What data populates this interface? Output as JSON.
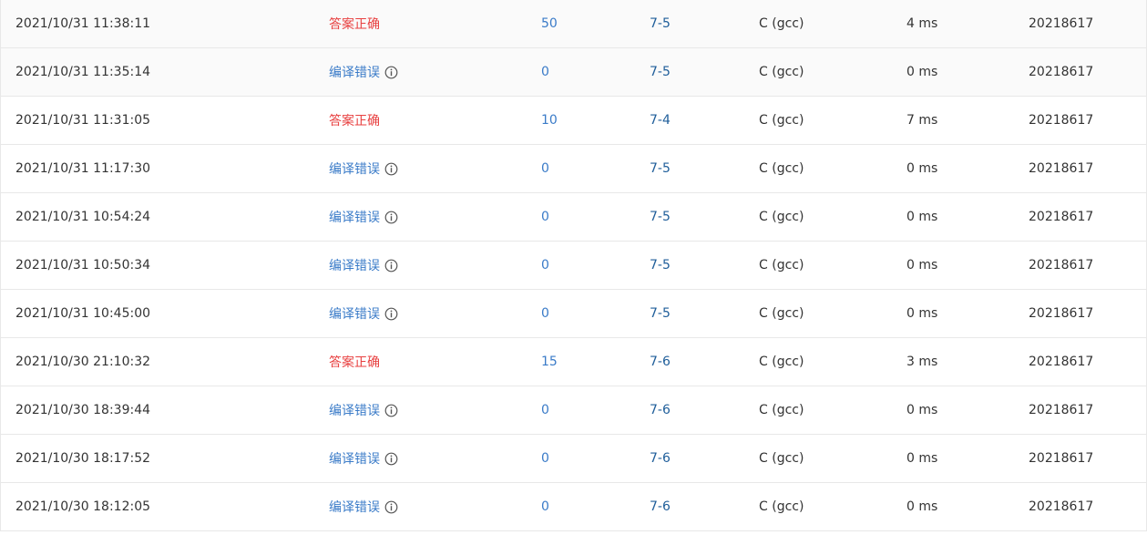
{
  "submissions": [
    {
      "time": "2021/10/31 11:38:11",
      "status": "答案正确",
      "status_type": "ok",
      "score": "50",
      "problem": "7-5",
      "language": "C (gcc)",
      "time_cost": "4 ms",
      "user": "20218617"
    },
    {
      "time": "2021/10/31 11:35:14",
      "status": "编译错误",
      "status_type": "ce",
      "score": "0",
      "problem": "7-5",
      "language": "C (gcc)",
      "time_cost": "0 ms",
      "user": "20218617"
    },
    {
      "time": "2021/10/31 11:31:05",
      "status": "答案正确",
      "status_type": "ok",
      "score": "10",
      "problem": "7-4",
      "language": "C (gcc)",
      "time_cost": "7 ms",
      "user": "20218617"
    },
    {
      "time": "2021/10/31 11:17:30",
      "status": "编译错误",
      "status_type": "ce",
      "score": "0",
      "problem": "7-5",
      "language": "C (gcc)",
      "time_cost": "0 ms",
      "user": "20218617"
    },
    {
      "time": "2021/10/31 10:54:24",
      "status": "编译错误",
      "status_type": "ce",
      "score": "0",
      "problem": "7-5",
      "language": "C (gcc)",
      "time_cost": "0 ms",
      "user": "20218617"
    },
    {
      "time": "2021/10/31 10:50:34",
      "status": "编译错误",
      "status_type": "ce",
      "score": "0",
      "problem": "7-5",
      "language": "C (gcc)",
      "time_cost": "0 ms",
      "user": "20218617"
    },
    {
      "time": "2021/10/31 10:45:00",
      "status": "编译错误",
      "status_type": "ce",
      "score": "0",
      "problem": "7-5",
      "language": "C (gcc)",
      "time_cost": "0 ms",
      "user": "20218617"
    },
    {
      "time": "2021/10/30 21:10:32",
      "status": "答案正确",
      "status_type": "ok",
      "score": "15",
      "problem": "7-6",
      "language": "C (gcc)",
      "time_cost": "3 ms",
      "user": "20218617"
    },
    {
      "time": "2021/10/30 18:39:44",
      "status": "编译错误",
      "status_type": "ce",
      "score": "0",
      "problem": "7-6",
      "language": "C (gcc)",
      "time_cost": "0 ms",
      "user": "20218617"
    },
    {
      "time": "2021/10/30 18:17:52",
      "status": "编译错误",
      "status_type": "ce",
      "score": "0",
      "problem": "7-6",
      "language": "C (gcc)",
      "time_cost": "0 ms",
      "user": "20218617"
    },
    {
      "time": "2021/10/30 18:12:05",
      "status": "编译错误",
      "status_type": "ce",
      "score": "0",
      "problem": "7-6",
      "language": "C (gcc)",
      "time_cost": "0 ms",
      "user": "20218617"
    }
  ],
  "colors": {
    "status_ok": "#e84040",
    "status_ce": "#3a7bc8",
    "score_link": "#3a7bc8",
    "problem_link": "#1f5e9a",
    "row_highlight": "#fafafa",
    "border": "#e8e8e8"
  },
  "icons": {
    "compile_error_info": "info-circle-icon"
  }
}
